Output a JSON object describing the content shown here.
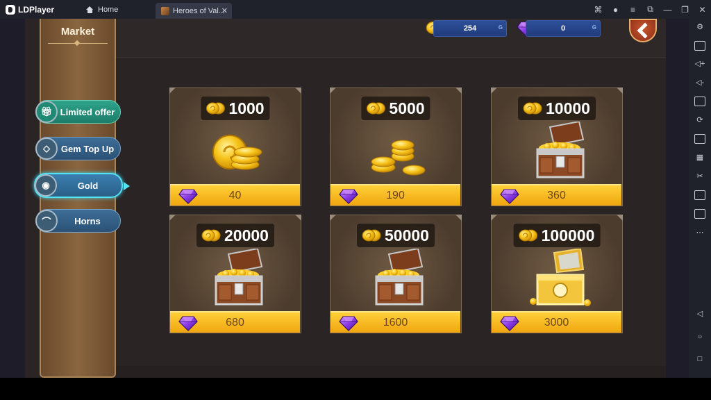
{
  "emulator": {
    "brand": "LDPlayer",
    "tabs": [
      {
        "label": "Home"
      },
      {
        "label": "Heroes of Val..."
      }
    ]
  },
  "currency": {
    "gold": "254",
    "gems": "0"
  },
  "market": {
    "title": "Market",
    "nav": [
      {
        "label": "Limited offer",
        "selected": false
      },
      {
        "label": "Gem Top Up",
        "selected": false
      },
      {
        "label": "Gold",
        "selected": true
      },
      {
        "label": "Horns",
        "selected": false
      }
    ]
  },
  "offers": [
    {
      "amount": "1000",
      "price": "40",
      "icon": "coin-stack-icon"
    },
    {
      "amount": "5000",
      "price": "190",
      "icon": "coin-pile-icon"
    },
    {
      "amount": "10000",
      "price": "360",
      "icon": "treasure-chest-icon"
    },
    {
      "amount": "20000",
      "price": "680",
      "icon": "treasure-chest-icon"
    },
    {
      "amount": "50000",
      "price": "1600",
      "icon": "treasure-chest-icon"
    },
    {
      "amount": "100000",
      "price": "3000",
      "icon": "golden-chest-icon"
    }
  ],
  "colors": {
    "accent_gold": "#ffc62a",
    "gem_purple": "#7a2fd6",
    "selected_glow": "#53e3f5"
  }
}
